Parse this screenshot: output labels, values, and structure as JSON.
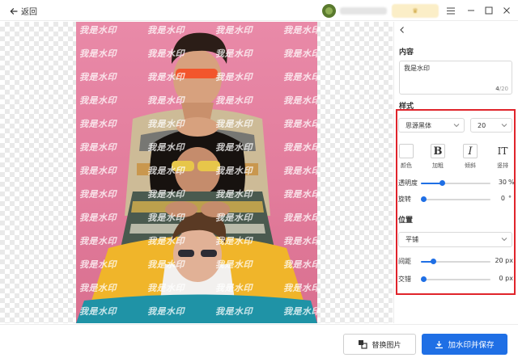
{
  "titlebar": {
    "back_label": "返回"
  },
  "watermark_text": "我是水印",
  "panel": {
    "content_title": "内容",
    "content_value": "我是水印",
    "counter_current": "4",
    "counter_max": "/20",
    "style_title": "样式",
    "font_family": "思源黑体",
    "font_size": "20",
    "style_buttons": [
      {
        "glyph": "",
        "label": "颜色"
      },
      {
        "glyph": "B",
        "label": "加粗"
      },
      {
        "glyph": "I",
        "label": "倾斜"
      },
      {
        "glyph": "IT",
        "label": "竖排"
      }
    ],
    "opacity_label": "透明度",
    "opacity_value": "30",
    "opacity_unit": "%",
    "opacity_fraction": 0.3,
    "rotate_label": "旋转",
    "rotate_value": "0",
    "rotate_unit": "°",
    "position_title": "位置",
    "position_mode": "平铺",
    "spacing_label": "间距",
    "spacing_value": "20 px",
    "spacing_fraction": 0.18,
    "stagger_label": "交错",
    "stagger_value": "0 px"
  },
  "footer": {
    "replace_label": "替换图片",
    "save_label": "加水印并保存"
  },
  "colors": {
    "accent": "#1f6fe5",
    "highlight_border": "#e0242b",
    "photo_bg": "#e07a9b"
  }
}
